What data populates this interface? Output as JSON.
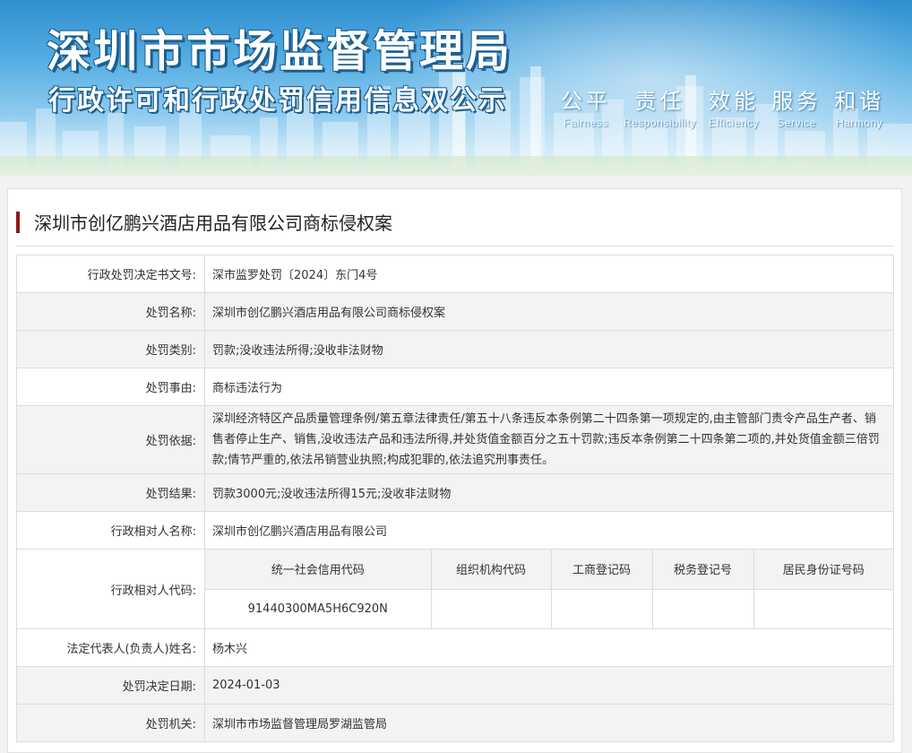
{
  "banner": {
    "title": "深圳市市场监督管理局",
    "subtitle": "行政许可和行政处罚信用信息双公示",
    "slogans": [
      {
        "zh": "公平",
        "en": "Fairness"
      },
      {
        "zh": "责任",
        "en": "Responsibility"
      },
      {
        "zh": "效能",
        "en": "Efficiency"
      },
      {
        "zh": "服务",
        "en": "Service"
      },
      {
        "zh": "和谐",
        "en": "Harmony"
      }
    ]
  },
  "case": {
    "title": "深圳市创亿鹏兴酒店用品有限公司商标侵权案"
  },
  "details": {
    "doc_no_label": "行政处罚决定书文号:",
    "doc_no": "深市监罗处罚〔2024〕东门4号",
    "name_label": "处罚名称:",
    "name": "深圳市创亿鹏兴酒店用品有限公司商标侵权案",
    "category_label": "处罚类别:",
    "category": "罚款;没收违法所得;没收非法财物",
    "reason_label": "处罚事由:",
    "reason": "商标违法行为",
    "basis_label": "处罚依据:",
    "basis": "深圳经济特区产品质量管理条例/第五章法律责任/第五十八条违反本条例第二十四条第一项规定的,由主管部门责令产品生产者、销售者停止生产、销售,没收违法产品和违法所得,并处货值金额百分之五十罚款;违反本条例第二十四条第二项的,并处货值金额三倍罚款;情节严重的,依法吊销营业执照;构成犯罪的,依法追究刑事责任。",
    "result_label": "处罚结果:",
    "result": "罚款3000元;没收违法所得15元;没收非法财物",
    "party_name_label": "行政相对人名称:",
    "party_name": "深圳市创亿鹏兴酒店用品有限公司",
    "party_code_label": "行政相对人代码:",
    "codes": {
      "headers": [
        "统一社会信用代码",
        "组织机构代码",
        "工商登记码",
        "税务登记号",
        "居民身份证号码"
      ],
      "values": [
        "91440300MA5H6C920N",
        "",
        "",
        "",
        ""
      ]
    },
    "legal_rep_label": "法定代表人(负责人)姓名:",
    "legal_rep": "杨木兴",
    "date_label": "处罚决定日期:",
    "date": "2024-01-03",
    "authority_label": "处罚机关:",
    "authority": "深圳市市场监督管理局罗湖监管局"
  }
}
